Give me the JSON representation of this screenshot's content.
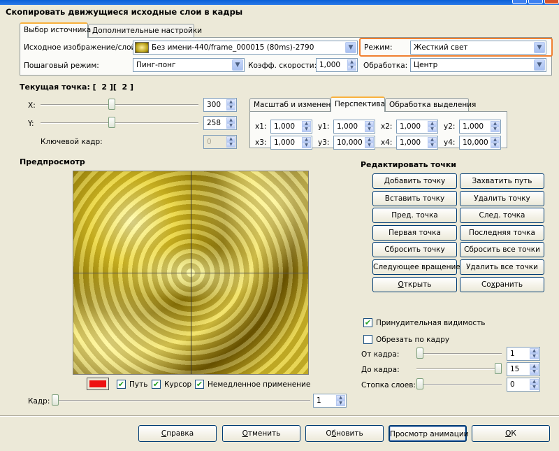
{
  "window": {
    "header": "Скопировать движущиеся исходные слои в кадры"
  },
  "tabs_top": [
    "Выбор источника",
    "Дополнительные настройки"
  ],
  "source": {
    "label": "Исходное изображение/слой:",
    "value": "Без имени-440/frame_000015 (80ms)-2790",
    "mode_label": "Режим:",
    "mode_value": "Жесткий свет",
    "step_label": "Пошаговый режим:",
    "step_value": "Пинг-понг",
    "speed_label": "Коэфф. скорости:",
    "speed_value": "1,000",
    "processing_label": "Обработка:",
    "processing_value": "Центр"
  },
  "current_point": {
    "label": "Текущая точка: [  2 ][  2 ]",
    "x_label": "X:",
    "x_value": "300",
    "x_level": 0.45,
    "y_label": "Y:",
    "y_value": "258",
    "y_level": 0.45,
    "keyframe_label": "Ключевой кадр:",
    "keyframe_value": "0"
  },
  "tabs_mid": [
    "Масштаб и изменение",
    "Перспектива",
    "Обработка выделения"
  ],
  "perspective": [
    {
      "label": "x1:",
      "value": "1,000"
    },
    {
      "label": "y1:",
      "value": "1,000"
    },
    {
      "label": "x2:",
      "value": "1,000"
    },
    {
      "label": "y2:",
      "value": "1,000"
    },
    {
      "label": "x3:",
      "value": "1,000"
    },
    {
      "label": "y3:",
      "value": "10,000"
    },
    {
      "label": "x4:",
      "value": "1,000"
    },
    {
      "label": "y4:",
      "value": "10,000"
    }
  ],
  "preview": {
    "label": "Предпросмотр"
  },
  "edit_points": {
    "label": "Редактировать точки",
    "buttons": [
      "Добавить точку",
      "Захватить путь",
      "Вставить точку",
      "Удалить точку",
      "Пред. точка",
      "След. точка",
      "Первая точка",
      "Последняя точка",
      "Сбросить точку",
      "Сбросить все точки",
      "Следующее вращение",
      "Удалить все точки",
      "Открыть",
      "Сохранить"
    ]
  },
  "options": {
    "force_visibility": "Принудительная видимость",
    "force_visibility_checked": true,
    "crop": "Обрезать по кадру",
    "crop_checked": false,
    "from_label": "От кадра:",
    "from_value": "1",
    "from_level": 0.0,
    "to_label": "До кадра:",
    "to_value": "15",
    "to_level": 1.0,
    "stack_label": "Стопка слоев:",
    "stack_value": "0",
    "stack_level": 0.0
  },
  "preview_opts": {
    "color": "#ee1111",
    "path": "Путь",
    "cursor": "Курсор",
    "instant": "Немедленное применение"
  },
  "frame": {
    "label": "Кадр:",
    "value": "1",
    "level": 0.0
  },
  "bottom_buttons": [
    "Справка",
    "Отменить",
    "Обновить",
    "Просмотр анимации",
    "ОК"
  ],
  "colors": {
    "highlight": "#f08030",
    "accent_tab": "#f9b13d"
  }
}
